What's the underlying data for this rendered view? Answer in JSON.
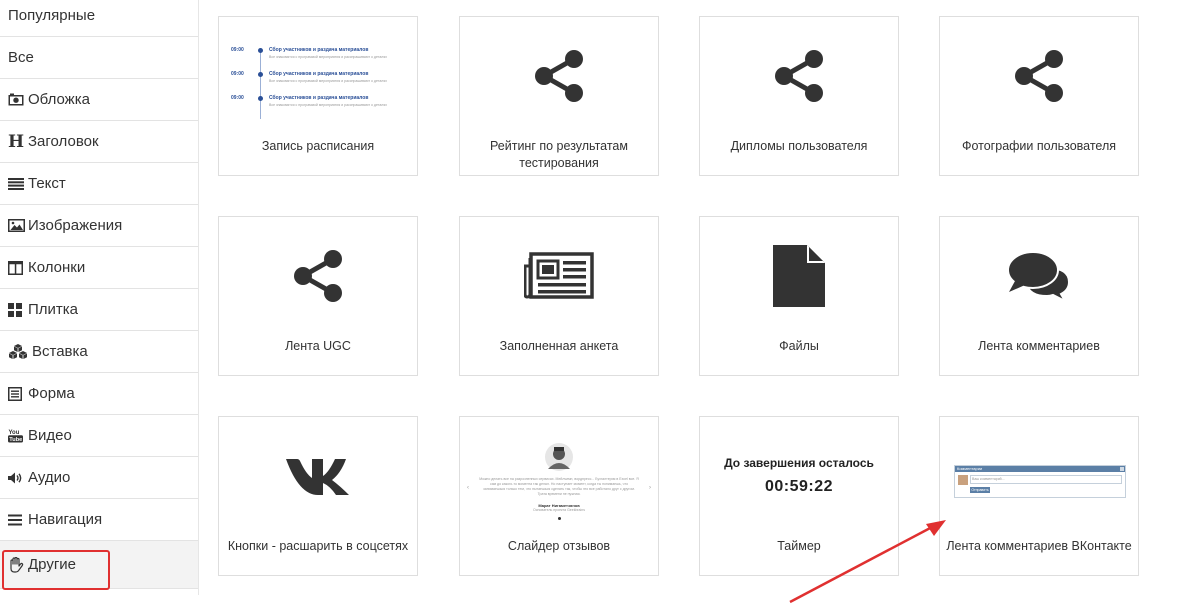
{
  "sidebar": {
    "items": [
      {
        "label": "Популярные",
        "icon": "none"
      },
      {
        "label": "Все",
        "icon": "none"
      },
      {
        "label": "Обложка",
        "icon": "camera-icon"
      },
      {
        "label": "Заголовок",
        "icon": "heading-icon"
      },
      {
        "label": "Текст",
        "icon": "text-lines-icon"
      },
      {
        "label": "Изображения",
        "icon": "image-icon"
      },
      {
        "label": "Колонки",
        "icon": "columns-icon"
      },
      {
        "label": "Плитка",
        "icon": "tiles-icon"
      },
      {
        "label": "Вставка",
        "icon": "cubes-icon"
      },
      {
        "label": "Форма",
        "icon": "form-icon"
      },
      {
        "label": "Видео",
        "icon": "youtube-icon"
      },
      {
        "label": "Аудио",
        "icon": "volume-icon"
      },
      {
        "label": "Навигация",
        "icon": "menu-icon"
      },
      {
        "label": "Другие",
        "icon": "hand-icon"
      }
    ],
    "active_index": 13
  },
  "cards": [
    {
      "label": "Запись расписания",
      "visual": "schedule-preview"
    },
    {
      "label": "Рейтинг по результатам тестирования",
      "visual": "share-icon"
    },
    {
      "label": "Дипломы пользователя",
      "visual": "share-icon"
    },
    {
      "label": "Фотографии пользователя",
      "visual": "share-icon"
    },
    {
      "label": "Лента UGC",
      "visual": "share-icon"
    },
    {
      "label": "Заполненная анкета",
      "visual": "newspaper-icon"
    },
    {
      "label": "Файлы",
      "visual": "file-icon"
    },
    {
      "label": "Лента комментариев",
      "visual": "comments-icon"
    },
    {
      "label": "Кнопки - расшарить в соцсетях",
      "visual": "vk-icon"
    },
    {
      "label": "Слайдер отзывов",
      "visual": "testimonial-preview"
    },
    {
      "label": "Таймер",
      "visual": "timer-preview"
    },
    {
      "label": "Лента комментариев ВКонтакте",
      "visual": "vk-comments-preview"
    }
  ],
  "schedule_preview": {
    "rows": [
      {
        "time": "09:00",
        "title": "Сбор участников и раздача материалов",
        "subtitle": "Все знакомятся с программой мероприятия и расспрашивают о деталях"
      },
      {
        "time": "09:00",
        "title": "Сбор участников и раздача материалов",
        "subtitle": "Все знакомятся с программой мероприятия и расспрашивают о деталях"
      },
      {
        "time": "09:00",
        "title": "Сбор участников и раздача материалов",
        "subtitle": "Все знакомятся с программой мероприятия и расспрашивают о деталях"
      }
    ]
  },
  "testimonial_preview": {
    "text": "Можно делать все на разрозненных сервисах. Мейлчимп, вордпресс... Бухгалтерия в Excel все. Я сам до какого-то момента так делал. Но наступает момент, когда ты понимаешь, что занимаешься только тем, что пытаешься сделать так, чтобы это все работало друг с другом. Трата времени не нужная.",
    "name": "Марат Нигаметзянов",
    "role": "Основатель проекта Geekbrains"
  },
  "timer_preview": {
    "caption": "До завершения осталось",
    "value": "00:59:22"
  },
  "vk_preview": {
    "header": "Комментарии",
    "placeholder": "Ваш комментарий...",
    "submit": "Отправить"
  },
  "colors": {
    "highlight": "#e03030",
    "arrow": "#e03030",
    "icon": "#333333",
    "schedule_accent": "#2a4f97",
    "vk_header": "#5b7fa6"
  }
}
